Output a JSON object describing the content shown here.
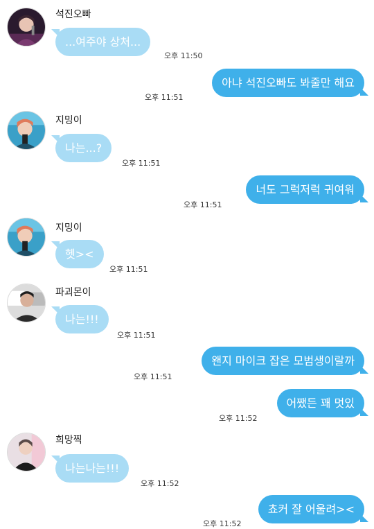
{
  "messages": [
    {
      "sender": "석진오빠",
      "text": "...여주야 상처...",
      "time": "오후 11:50"
    },
    {
      "text": "아냐 석진오빠도 봐줄만 해요",
      "time": "오후 11:51"
    },
    {
      "sender": "지밍이",
      "text": "나는...?",
      "time": "오후 11:51"
    },
    {
      "text": "너도 그럭저럭 귀여워",
      "time": "오후 11:51"
    },
    {
      "sender": "지밍이",
      "text": "헷><",
      "time": "오후 11:51"
    },
    {
      "sender": "파괴몬이",
      "text": "나는!!!",
      "time": "오후 11:51"
    },
    {
      "text": "왠지 마이크 잡은 모범생이랄까",
      "time": "오후 11:51"
    },
    {
      "text": "어쨌든 꽤 멋있",
      "time": "오후 11:52"
    },
    {
      "sender": "희망찍",
      "text": "나는나는!!!",
      "time": "오후 11:52"
    },
    {
      "text": "쵸커 잘 어울려><",
      "time": "오후 11:52"
    }
  ],
  "colors": {
    "incoming_bubble": "#a9dcf5",
    "outgoing_bubble": "#3fb0ea"
  },
  "icons": [
    "avatar-seokjin",
    "avatar-jimin",
    "avatar-jimin",
    "avatar-namjoon",
    "avatar-hoseok"
  ]
}
